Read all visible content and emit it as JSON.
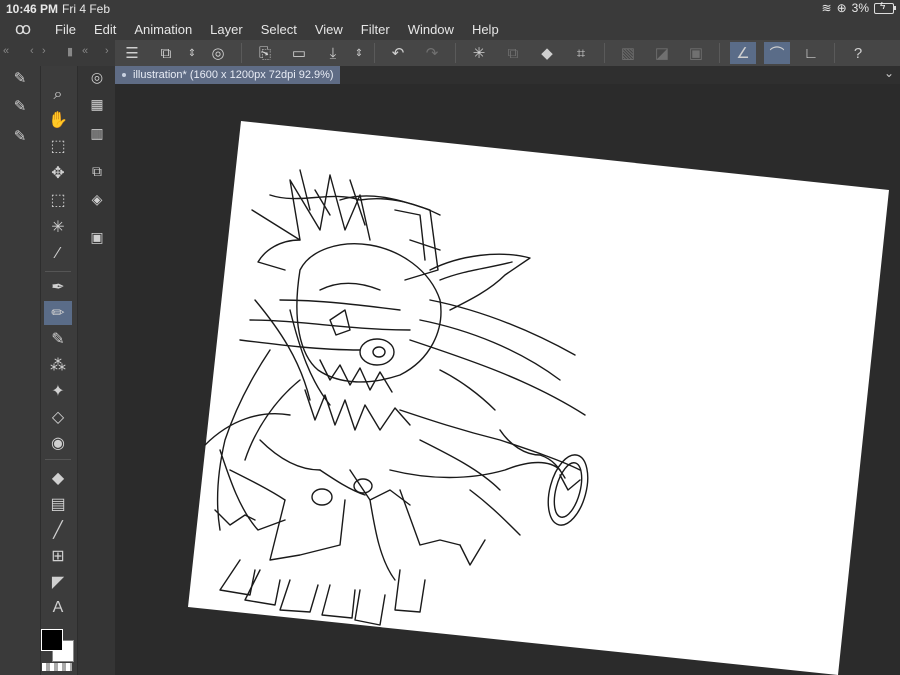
{
  "status_bar": {
    "time": "10:46 PM",
    "date": "Fri 4 Feb",
    "battery": "3%"
  },
  "menu": {
    "items": [
      "File",
      "Edit",
      "Animation",
      "Layer",
      "Select",
      "View",
      "Filter",
      "Window",
      "Help"
    ]
  },
  "document_tab": {
    "title": "illustration* (1600 x 1200px 72dpi 92.9%)"
  },
  "toolbar": {
    "icons": [
      "menu-icon",
      "transform-icon",
      "up-down-icon",
      "lasso-icon",
      "new-canvas-icon",
      "open-folder-icon",
      "save-icon",
      "up-down-icon",
      "undo-icon",
      "redo-icon",
      "loading-icon",
      "copy-icon",
      "fill-icon",
      "crop-icon",
      "deselect-icon",
      "invert-selection-icon",
      "clear-icon",
      "stabilizer-icon",
      "snap-ruler-icon",
      "snap-special-icon",
      "help-icon"
    ]
  },
  "colors": {
    "accent": "#5a6c88",
    "panel": "#3a3a3a",
    "workspace": "#2b2b2b",
    "canvas": "#ffffff",
    "foreground_color": "#000000",
    "background_color": "#ffffff"
  }
}
